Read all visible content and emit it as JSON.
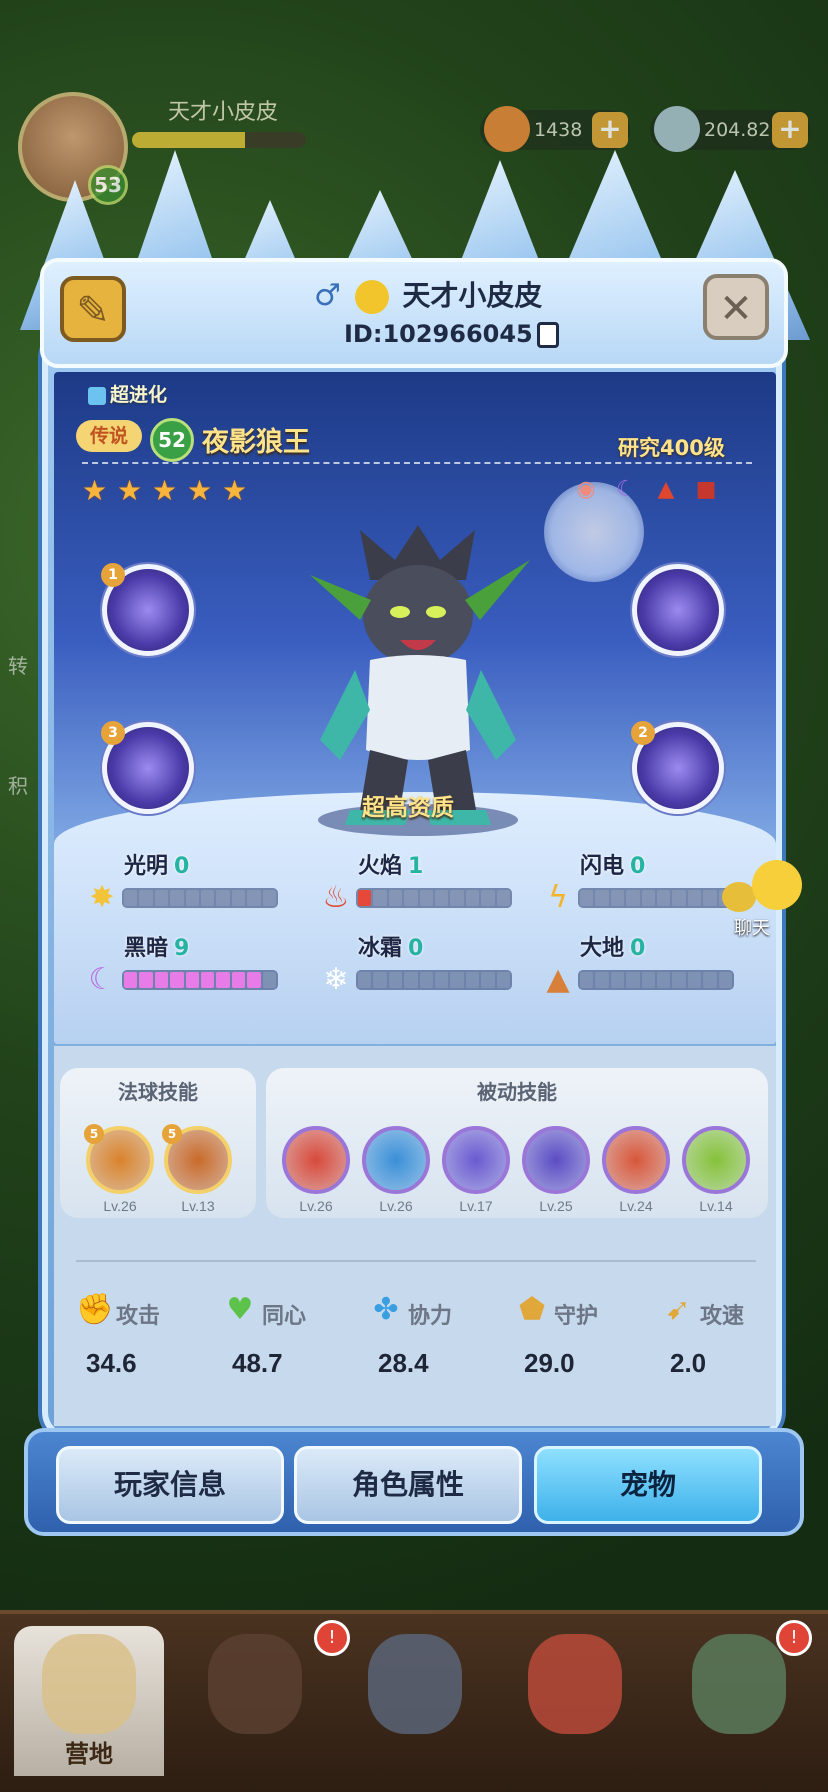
{
  "player": {
    "name": "天才小皮皮",
    "level": "53",
    "xp_progress": 0.65
  },
  "resources": [
    {
      "name": "gold-fish",
      "value": "1438"
    },
    {
      "name": "shell",
      "value": "204.82M"
    }
  ],
  "sidebar_hints": [
    "转",
    "积"
  ],
  "profile": {
    "gender_symbol": "♂",
    "name": "天才小皮皮",
    "id": "ID:102966045"
  },
  "pet": {
    "evolution": "超进化",
    "rarity": "传说",
    "level": "52",
    "name": "夜影狼王",
    "research": "研究400级",
    "stars": 5,
    "quality": "超高资质",
    "trait_icons": [
      "pig-icon",
      "moon-icon",
      "flame-icon",
      "scroll-icon"
    ],
    "skill_slots": [
      {
        "num": "1",
        "icon": "wolf-spirit-icon"
      },
      {
        "num": "",
        "icon": "owl-spirit-icon"
      },
      {
        "num": "3",
        "icon": "wind-slash-icon"
      },
      {
        "num": "2",
        "icon": "wolf-howl-icon"
      }
    ]
  },
  "elements": [
    {
      "name": "光明",
      "value": "0",
      "icon": "sun-icon",
      "filled": 0
    },
    {
      "name": "火焰",
      "value": "1",
      "icon": "fire-icon",
      "filled": 1
    },
    {
      "name": "闪电",
      "value": "0",
      "icon": "lightning-icon",
      "filled": 0
    },
    {
      "name": "黑暗",
      "value": "9",
      "icon": "moon-icon",
      "filled": 9
    },
    {
      "name": "冰霜",
      "value": "0",
      "icon": "snowflake-icon",
      "filled": 0
    },
    {
      "name": "大地",
      "value": "0",
      "icon": "earth-icon",
      "filled": 0
    }
  ],
  "skills": {
    "orb_title": "法球技能",
    "passive_title": "被动技能",
    "orb": [
      {
        "lv": "Lv.26",
        "badge": "5",
        "color": "#d9822b"
      },
      {
        "lv": "Lv.13",
        "badge": "5",
        "color": "#c96a2a"
      }
    ],
    "passive": [
      {
        "lv": "Lv.26",
        "color": "#d84a3a"
      },
      {
        "lv": "Lv.26",
        "color": "#3a8fd8"
      },
      {
        "lv": "Lv.17",
        "color": "#6a5ad0"
      },
      {
        "lv": "Lv.25",
        "color": "#5b4cc4"
      },
      {
        "lv": "Lv.24",
        "color": "#d8573a"
      },
      {
        "lv": "Lv.14",
        "color": "#86c23a"
      }
    ]
  },
  "stats": [
    {
      "label": "攻击",
      "value": "34.6",
      "icon": "fist-icon"
    },
    {
      "label": "同心",
      "value": "48.7",
      "icon": "heart-icon"
    },
    {
      "label": "协力",
      "value": "28.4",
      "icon": "cooperation-icon"
    },
    {
      "label": "守护",
      "value": "29.0",
      "icon": "shield-icon"
    },
    {
      "label": "攻速",
      "value": "2.0",
      "icon": "speed-icon"
    }
  ],
  "tabs": [
    "玩家信息",
    "角色属性",
    "宠物"
  ],
  "chat": "聊天",
  "bottom_nav": [
    {
      "label": "营地"
    },
    {
      "label": ""
    },
    {
      "label": ""
    },
    {
      "label": ""
    },
    {
      "label": ""
    }
  ]
}
